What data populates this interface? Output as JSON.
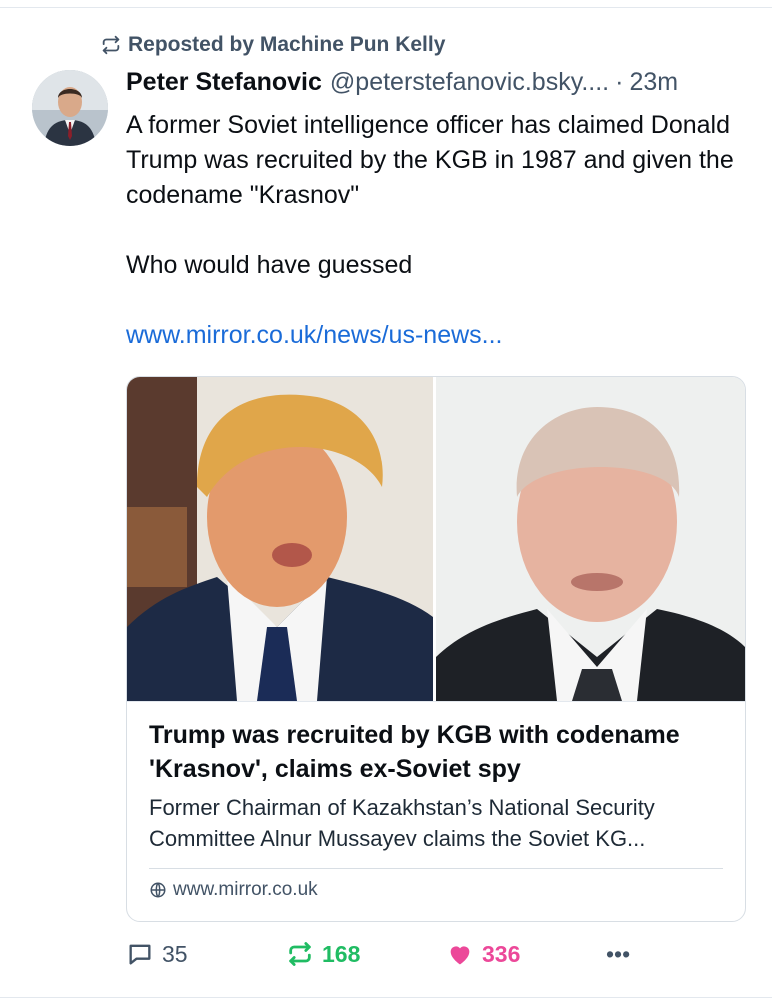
{
  "repost": {
    "label": "Reposted by Machine Pun Kelly",
    "icon": "repost-icon"
  },
  "post": {
    "author_name": "Peter Stefanovic",
    "author_handle": "@peterstefanovic.bsky....",
    "separator": "·",
    "time": "23m",
    "text_line1": "A former Soviet intelligence officer has claimed Donald Trump was recruited by the KGB in 1987 and given the codename \"Krasnov\"",
    "text_line2": "Who would have guessed",
    "link": "www.mirror.co.uk/news/us-news..."
  },
  "card": {
    "title": "Trump was recruited by KGB with codename 'Krasnov', claims ex-Soviet spy",
    "description": "Former Chairman of Kazakhstan’s National Security Committee Alnur Mussayev claims the Soviet KG...",
    "domain": "www.mirror.co.uk"
  },
  "actions": {
    "replies": "35",
    "reposts": "168",
    "likes": "336",
    "more": "•••"
  },
  "colors": {
    "muted": "#425366",
    "link": "#1a6bd8",
    "repost_active": "#20bc63",
    "like_active": "#ec4899"
  }
}
